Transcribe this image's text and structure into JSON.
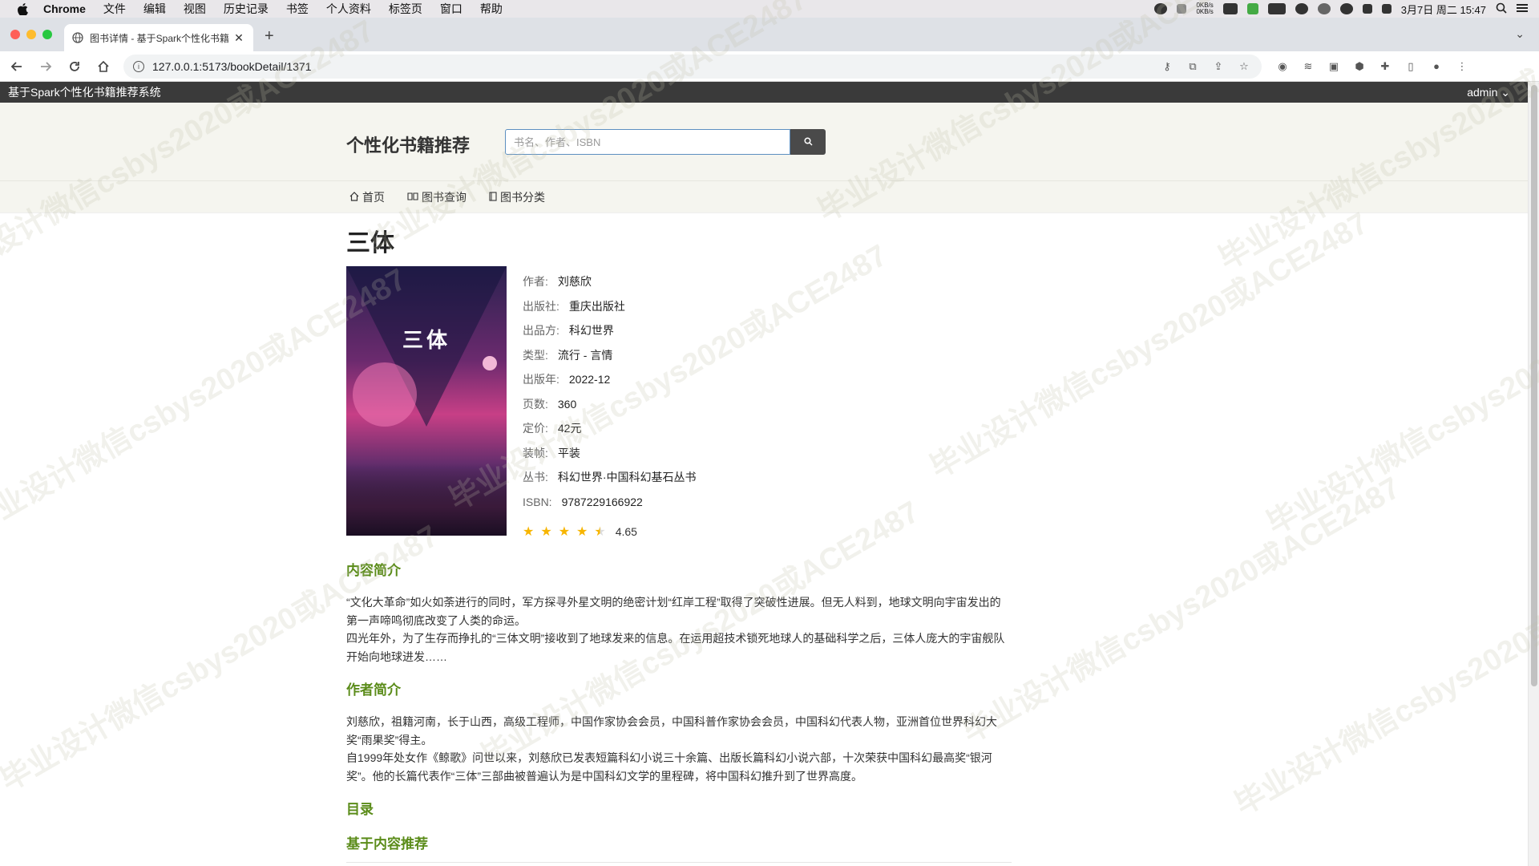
{
  "mac_menubar": {
    "app_name": "Chrome",
    "menus": [
      "文件",
      "编辑",
      "视图",
      "历史记录",
      "书签",
      "个人资料",
      "标签页",
      "窗口",
      "帮助"
    ],
    "net_up": "0KB/s",
    "net_down": "0KB/s",
    "datetime": "3月7日 周二 15:47"
  },
  "browser": {
    "tab_title": "图书详情 - 基于Spark个性化书籍",
    "url": "127.0.0.1:5173/bookDetail/1371",
    "new_tab_label": "+"
  },
  "app": {
    "system_title": "基于Spark个性化书籍推荐系统",
    "user": "admin",
    "site_title": "个性化书籍推荐",
    "search_placeholder": "书名、作者、ISBN",
    "nav": [
      "首页",
      "图书查询",
      "图书分类"
    ]
  },
  "book": {
    "title": "三体",
    "cover_title": "三体",
    "meta": [
      {
        "label": "作者:",
        "value": "刘慈欣"
      },
      {
        "label": "出版社:",
        "value": "重庆出版社"
      },
      {
        "label": "出品方:",
        "value": "科幻世界"
      },
      {
        "label": "类型:",
        "value": "流行 - 言情"
      },
      {
        "label": "出版年:",
        "value": "2022-12"
      },
      {
        "label": "页数:",
        "value": "360"
      },
      {
        "label": "定价:",
        "value": "42元"
      },
      {
        "label": "装帧:",
        "value": "平装"
      },
      {
        "label": "丛书:",
        "value": "科幻世界·中国科幻基石丛书"
      },
      {
        "label": "ISBN:",
        "value": "9787229166922"
      }
    ],
    "rating": "4.65",
    "rating_stars": 4.5
  },
  "sections": {
    "intro_title": "内容简介",
    "intro_p1": "“文化大革命”如火如荼进行的同时，军方探寻外星文明的绝密计划“红岸工程”取得了突破性进展。但无人料到，地球文明向宇宙发出的第一声啼鸣彻底改变了人类的命运。",
    "intro_p2": "四光年外，为了生存而挣扎的“三体文明”接收到了地球发来的信息。在运用超技术锁死地球人的基础科学之后，三体人庞大的宇宙舰队开始向地球进发……",
    "author_title": "作者简介",
    "author_p1": "刘慈欣，祖籍河南，长于山西，高级工程师，中国作家协会会员，中国科普作家协会会员，中国科幻代表人物，亚洲首位世界科幻大奖“雨果奖”得主。",
    "author_p2": "自1999年处女作《鲸歌》问世以来，刘慈欣已发表短篇科幻小说三十余篇、出版长篇科幻小说六部，十次荣获中国科幻最高奖“银河奖”。他的长篇代表作“三体”三部曲被普遍认为是中国科幻文学的里程碑，将中国科幻推升到了世界高度。",
    "toc_title": "目录",
    "recommend_title": "基于内容推荐"
  },
  "watermark_text": "毕业设计微信csbys2020或ACE2487"
}
